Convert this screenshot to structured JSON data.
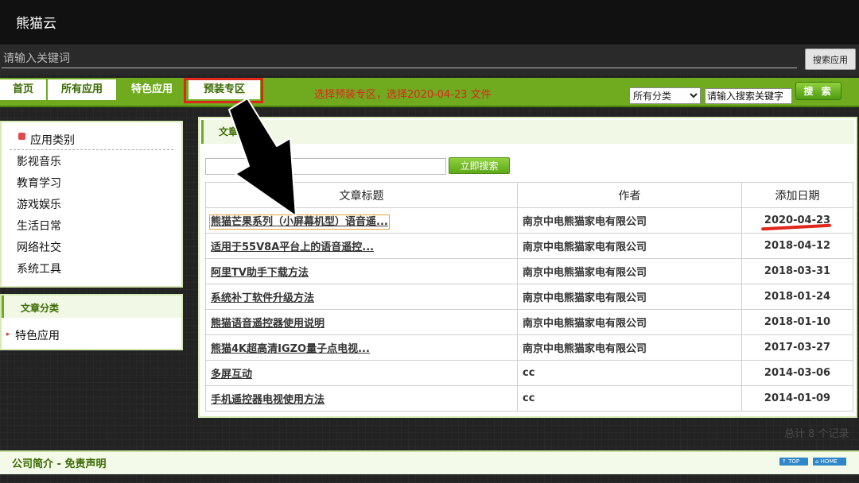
{
  "app": {
    "title": "熊猫云"
  },
  "search": {
    "placeholder": "请输入关键词",
    "button_label": "搜索应用"
  },
  "nav": {
    "tabs": [
      {
        "label": "首页"
      },
      {
        "label": "所有应用"
      },
      {
        "label": "特色应用"
      },
      {
        "label": "预装专区"
      }
    ],
    "annotation": "选择预装专区，选择2020-04-23 文件",
    "category_select": "所有分类",
    "keyword_placeholder": "请输入搜索关键字",
    "search_button": "搜 索"
  },
  "sidebar": {
    "category_header": "应用类别",
    "categories": [
      "影视音乐",
      "教育学习",
      "游戏娱乐",
      "生活日常",
      "网络社交",
      "系统工具"
    ],
    "article_category_header": "文章分类",
    "article_categories": [
      "特色应用"
    ]
  },
  "main": {
    "header": "文章列",
    "search_button": "立即搜索",
    "columns": [
      "文章标题",
      "作者",
      "添加日期"
    ],
    "rows": [
      {
        "title": "熊猫芒果系列（小屏幕机型）语音遥...",
        "author": "南京中电熊猫家电有限公司",
        "date": "2020-04-23"
      },
      {
        "title": "适用于55V8A平台上的语音遥控...",
        "author": "南京中电熊猫家电有限公司",
        "date": "2018-04-12"
      },
      {
        "title": "阿里TV助手下载方法",
        "author": "南京中电熊猫家电有限公司",
        "date": "2018-03-31"
      },
      {
        "title": "系统补丁软件升级方法",
        "author": "南京中电熊猫家电有限公司",
        "date": "2018-01-24"
      },
      {
        "title": "熊猫语音遥控器使用说明",
        "author": "南京中电熊猫家电有限公司",
        "date": "2018-01-10"
      },
      {
        "title": "熊猫4K超高清IGZO量子点电视...",
        "author": "南京中电熊猫家电有限公司",
        "date": "2017-03-27"
      },
      {
        "title": "多屏互动",
        "author": "cc",
        "date": "2014-03-06"
      },
      {
        "title": "手机遥控器电视使用方法",
        "author": "cc",
        "date": "2014-01-09"
      }
    ],
    "total_records": "总计 8 个记录"
  },
  "footer": {
    "link": "公司简介 - 免责声明",
    "top_label": "↑ TOP",
    "home_label": "⌂ HOME"
  },
  "colors": {
    "accent_green": "#6faa1f",
    "annotation_red": "#e1261c"
  }
}
